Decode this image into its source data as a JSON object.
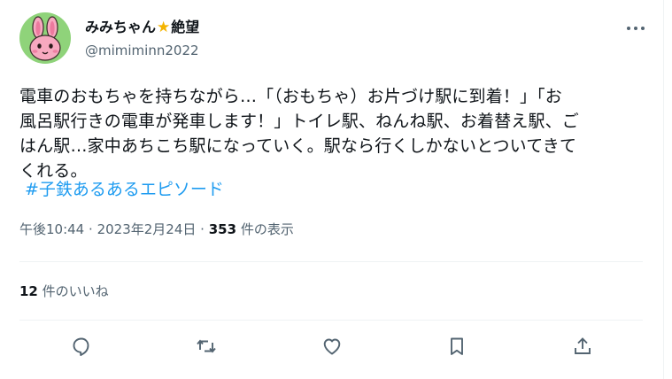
{
  "author": {
    "display_name": "みみちゃん",
    "display_name_suffix": "絶望",
    "name_emoji": "★",
    "handle": "@mimiminn2022",
    "avatar_icon": "rabbit-avatar-icon"
  },
  "tweet": {
    "text_lines": [
      "電車のおもちゃを持ちながら…「（おもちゃ）お片づけ駅に到着！」「お",
      "風呂駅行きの電車が発車します！」トイレ駅、ねんね駅、お着替え駅、ご",
      "はん駅…家中あちこち駅になっていく。駅なら行くしかないとついてきて",
      "くれる。"
    ],
    "hashtag": "#子鉄あるあるエピソード",
    "time": "午後10:44",
    "date": "2023年2月24日",
    "separator": "·",
    "views_count": "353",
    "views_label": "件の表示"
  },
  "engagement": {
    "likes_count": "12",
    "likes_label": "件のいいね"
  },
  "actions": [
    {
      "name": "reply-icon"
    },
    {
      "name": "retweet-icon"
    },
    {
      "name": "like-icon"
    },
    {
      "name": "bookmark-icon"
    },
    {
      "name": "share-icon"
    }
  ],
  "colors": {
    "link": "#1d9bf0",
    "secondary_text": "#536471",
    "primary_text": "#0f1419",
    "avatar_bg": "#8fd37a",
    "star": "#f4b400"
  }
}
